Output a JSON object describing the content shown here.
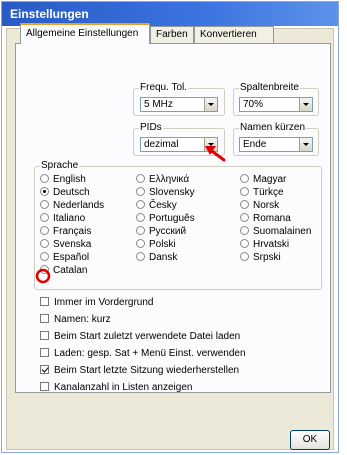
{
  "window": {
    "title": "Einstellungen"
  },
  "tabs": [
    "Allgemeine Einstellungen",
    "Farben",
    "Konvertieren"
  ],
  "freq": {
    "label": "Frequ. Tol.",
    "value": "5 MHz"
  },
  "spalten": {
    "label": "Spaltenbreite",
    "value": "70%"
  },
  "pids": {
    "label": "PIDs",
    "value": "dezimal"
  },
  "namen": {
    "label": "Namen kürzen",
    "value": "Ende"
  },
  "sprache": {
    "label": "Sprache",
    "selected": "Deutsch",
    "col1": [
      "English",
      "Deutsch",
      "Nederlands",
      "Italiano",
      "Français",
      "Svenska",
      "Español",
      "Catalan"
    ],
    "col2": [
      "Ελληνικά",
      "Slovensky",
      "Česky",
      "Português",
      "Русский",
      "Polski",
      "Dansk"
    ],
    "col3": [
      "Magyar",
      "Türkçe",
      "Norsk",
      "Romana",
      "Suomalainen",
      "Hrvatski",
      "Srpski"
    ]
  },
  "options": [
    {
      "label": "Immer im Vordergrund",
      "checked": false
    },
    {
      "label": "Namen: kurz",
      "checked": false
    },
    {
      "label": "Beim Start zuletzt verwendete Datei laden",
      "checked": false
    },
    {
      "label": "Laden: gesp. Sat + Menü Einst. verwenden",
      "checked": false
    },
    {
      "label": "Beim Start letzte Sitzung wiederherstellen",
      "checked": true
    },
    {
      "label": "Kanalanzahl in Listen anzeigen",
      "checked": false
    }
  ],
  "ok_label": "OK",
  "annotation_color": "#e00000"
}
